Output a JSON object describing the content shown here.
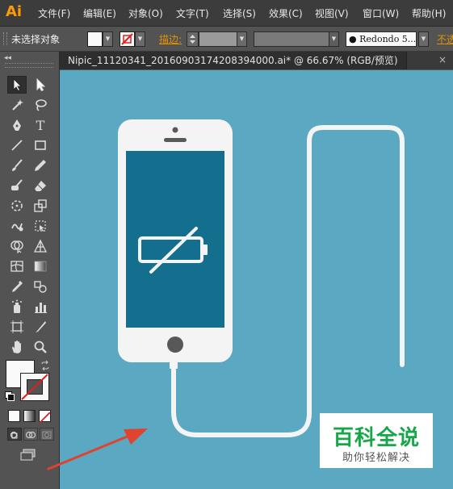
{
  "app": {
    "logo": "Ai",
    "menu": [
      "文件(F)",
      "编辑(E)",
      "对象(O)",
      "文字(T)",
      "选择(S)",
      "效果(C)",
      "视图(V)",
      "窗口(W)",
      "帮助(H)"
    ]
  },
  "control_bar": {
    "selection_status": "未选择对象",
    "stroke_label": "描边:",
    "font_value": "Redondo 5...",
    "opacity_label": "不透"
  },
  "document": {
    "tab_title": "Nipic_11120341_20160903174208394000.ai* @ 66.67% (RGB/预览)",
    "close_glyph": "×"
  },
  "canvas": {
    "background_color": "#5aa8c2",
    "phone_color": "#f4f4f4",
    "screen_color": "#136f8d",
    "cable_color": "#f4f4f4"
  },
  "watermark": {
    "title": "百科全说",
    "subtitle": "助你轻松解决",
    "title_color": "#17a64a"
  },
  "annotation": {
    "arrow_color": "#e0432e"
  },
  "toolbox": {
    "collapse_glyph": "◂◂",
    "tools": [
      "selection",
      "direct-selection",
      "magic-wand",
      "lasso",
      "pen",
      "type",
      "line-segment",
      "rectangle",
      "paintbrush",
      "pencil",
      "blob-brush",
      "eraser",
      "rotate",
      "scale",
      "warp",
      "free-transform",
      "shape-builder",
      "perspective-grid",
      "mesh",
      "gradient",
      "eyedropper",
      "blend",
      "symbol-sprayer",
      "column-graph",
      "artboard",
      "slice",
      "hand",
      "zoom"
    ]
  }
}
